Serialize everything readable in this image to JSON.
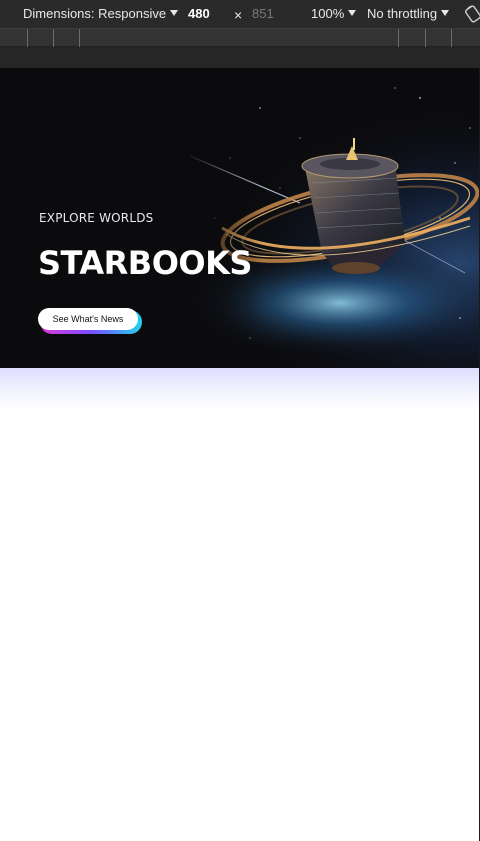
{
  "devtools": {
    "dimensions_label": "Dimensions: Responsive",
    "width_value": "480",
    "times_symbol": "×",
    "height_value": "851",
    "zoom_label": "100%",
    "throttling_label": "No throttling",
    "rotate_icon": "rotate-icon"
  },
  "hero": {
    "kicker": "EXPLORE WORLDS",
    "title": "STARBOOKS",
    "cta_label": "See What's News",
    "cta_gradient": [
      "#e03ad6",
      "#7c4dff",
      "#22d3ee"
    ],
    "background_color": "#0b0b0d",
    "art_description_icon": "space-station-illustration"
  },
  "page": {
    "fade_color": "#dcdcff",
    "body_color": "#ffffff"
  }
}
